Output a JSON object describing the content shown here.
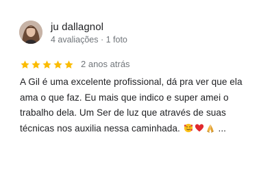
{
  "review": {
    "author_name": "ju dallagnol",
    "author_meta": "4 avaliações · 1 foto",
    "rating": 5,
    "rating_max": 5,
    "date": "2 anos atrás",
    "text_lines": [
      "A Gil é uma excelente profissional,  dá pra ver que ela",
      "ama o que faz. Eu mais que indico e super amei o",
      "trabalho dela.  Um Ser de luz que através de suas",
      "técnicas nos auxilia nessa caminhada."
    ],
    "text_suffix": "...",
    "emojis": [
      "smiling-face-with-hearts-icon",
      "red-heart-icon",
      "folded-hands-icon"
    ],
    "star_color": "#fbbc04"
  }
}
